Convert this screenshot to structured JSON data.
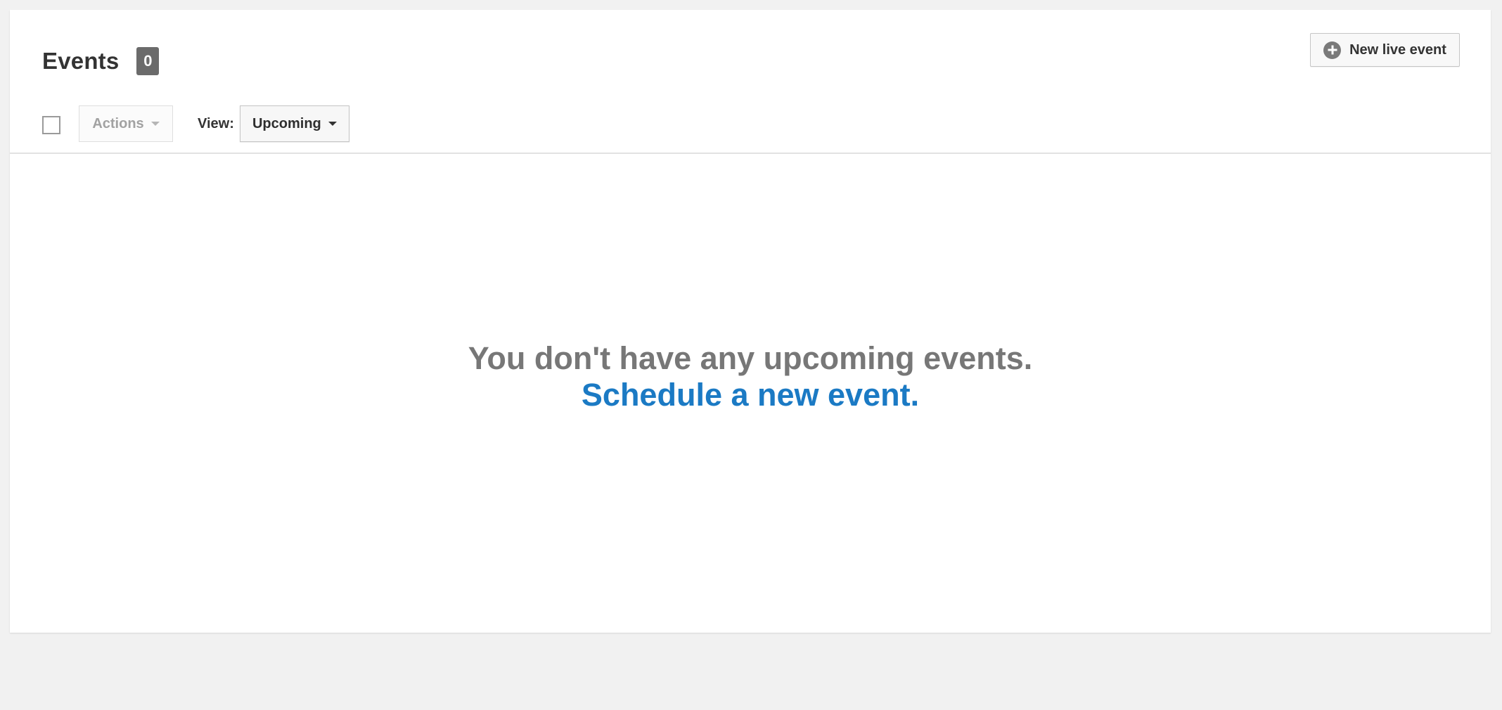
{
  "header": {
    "title": "Events",
    "count": "0",
    "new_live_event_label": "New live event"
  },
  "toolbar": {
    "actions_label": "Actions",
    "view_label": "View:",
    "view_selected": "Upcoming"
  },
  "empty_state": {
    "message": "You don't have any upcoming events.",
    "link_label": "Schedule a new event."
  },
  "icons": {
    "new_live_event": "plus-circle-icon",
    "dropdown": "caret-down-icon"
  },
  "colors": {
    "link": "#1b7ac4",
    "badge": "#6b6b6b",
    "muted_text": "#777777"
  }
}
